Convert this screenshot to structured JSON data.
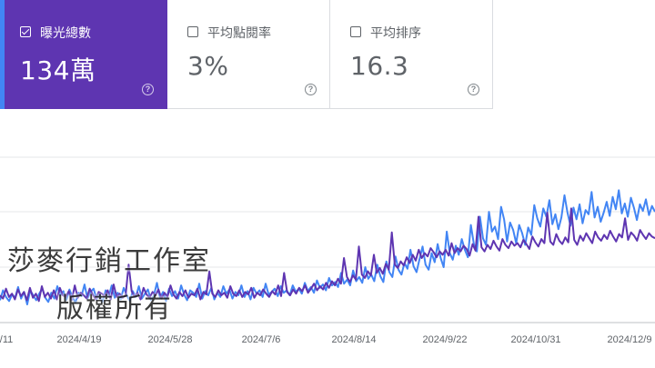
{
  "metrics": [
    {
      "label": "曝光總數",
      "value": "134萬",
      "checked": true
    },
    {
      "label": "平均點閱率",
      "value": "3%",
      "checked": false
    },
    {
      "label": "平均排序",
      "value": "16.3",
      "checked": false
    }
  ],
  "help_glyph": "?",
  "watermark": {
    "line1": "莎麥行銷工作室",
    "line2": "版權所有"
  },
  "chart_data": {
    "type": "line",
    "title": "",
    "xlabel": "",
    "ylabel": "",
    "x_ticks": [
      "/11",
      "2024/4/19",
      "2024/5/28",
      "2024/7/6",
      "2024/8/14",
      "2024/9/22",
      "2024/10/31",
      "2024/12/9"
    ],
    "y_axis_labels_visible": false,
    "grid": true,
    "series": [
      {
        "color": "#4285f4",
        "values": [
          27,
          39,
          31,
          26,
          34,
          30,
          43,
          29,
          37,
          22,
          39,
          33,
          27,
          35,
          41,
          30,
          25,
          36,
          29,
          44,
          33,
          38,
          27,
          40,
          31,
          24,
          36,
          32,
          46,
          29,
          37,
          41,
          28,
          34,
          25,
          39,
          31,
          45,
          30,
          36,
          28,
          42,
          33,
          26,
          38,
          31,
          44,
          29,
          35,
          40,
          27,
          33,
          48,
          30,
          37,
          26,
          41,
          32,
          38,
          29,
          45,
          34,
          27,
          39,
          36,
          31,
          47,
          29,
          38,
          33,
          42,
          28,
          36,
          31,
          44,
          35,
          40,
          29,
          37,
          33,
          45,
          31,
          38,
          28,
          42,
          35,
          39,
          31,
          47,
          34,
          37,
          41,
          32,
          44,
          36,
          39,
          33,
          45,
          37,
          41,
          35,
          48,
          38,
          43,
          36,
          51,
          42,
          46,
          39,
          54,
          45,
          49,
          43,
          60,
          47,
          52,
          45,
          63,
          50,
          55,
          48,
          67,
          53,
          58,
          50,
          70,
          56,
          49,
          74,
          61,
          55,
          80,
          64,
          58,
          72,
          65,
          88,
          68,
          61,
          77,
          92,
          70,
          64,
          84,
          73,
          95,
          78,
          67,
          110,
          84,
          76,
          93,
          82,
          101,
          88,
          79,
          118,
          95,
          86,
          128,
          102,
          94,
          134,
          110,
          116,
          101,
          140,
          125,
          98,
          121,
          112,
          96,
          118,
          108,
          94,
          115,
          106,
          142,
          126,
          116,
          138,
          128,
          148,
          119,
          131,
          113,
          127,
          154,
          133,
          117,
          139,
          125,
          143,
          120,
          136,
          131,
          158,
          127,
          140,
          122,
          133,
          146,
          129,
          152,
          137,
          160,
          132,
          144,
          128,
          151,
          139,
          124,
          143,
          135,
          149,
          130,
          141,
          134
        ],
        "name": ""
      },
      {
        "color": "#5e35b1",
        "values": [
          33,
          29,
          41,
          31,
          35,
          28,
          40,
          32,
          37,
          27,
          42,
          30,
          35,
          26,
          44,
          31,
          36,
          29,
          39,
          28,
          42,
          33,
          31,
          38,
          27,
          45,
          30,
          36,
          33,
          29,
          41,
          34,
          28,
          37,
          35,
          32,
          39,
          28,
          46,
          31,
          35,
          30,
          33,
          70,
          38,
          31,
          36,
          28,
          42,
          34,
          30,
          37,
          33,
          40,
          29,
          36,
          31,
          45,
          34,
          29,
          37,
          32,
          39,
          30,
          35,
          33,
          41,
          28,
          37,
          34,
          62,
          35,
          31,
          39,
          33,
          36,
          30,
          44,
          35,
          32,
          39,
          31,
          37,
          34,
          42,
          30,
          36,
          33,
          40,
          35,
          31,
          38,
          34,
          45,
          32,
          60,
          37,
          33,
          40,
          35,
          42,
          38,
          45,
          36,
          41,
          47,
          39,
          44,
          40,
          48,
          42,
          50,
          45,
          53,
          47,
          78,
          55,
          49,
          57,
          52,
          92,
          58,
          54,
          62,
          57,
          82,
          60,
          66,
          59,
          71,
          64,
          109,
          70,
          66,
          74,
          69,
          79,
          72,
          82,
          75,
          88,
          78,
          84,
          80,
          90,
          85,
          79,
          86,
          82,
          88,
          81,
          96,
          84,
          90,
          86,
          93,
          89,
          81,
          95,
          87,
          128,
          91,
          86,
          94,
          89,
          99,
          92,
          87,
          101,
          94,
          90,
          98,
          93,
          96,
          91,
          100,
          95,
          89,
          104,
          97,
          92,
          101,
          96,
          133,
          98,
          94,
          107,
          99,
          95,
          103,
          97,
          138,
          100,
          94,
          105,
          99,
          108,
          102,
          96,
          110,
          103,
          99,
          106,
          101,
          111,
          104,
          98,
          107,
          103,
          126,
          100,
          109,
          105,
          99,
          112,
          106,
          101,
          108,
          104,
          102
        ]
      }
    ],
    "ylim": [
      0,
      200
    ]
  }
}
